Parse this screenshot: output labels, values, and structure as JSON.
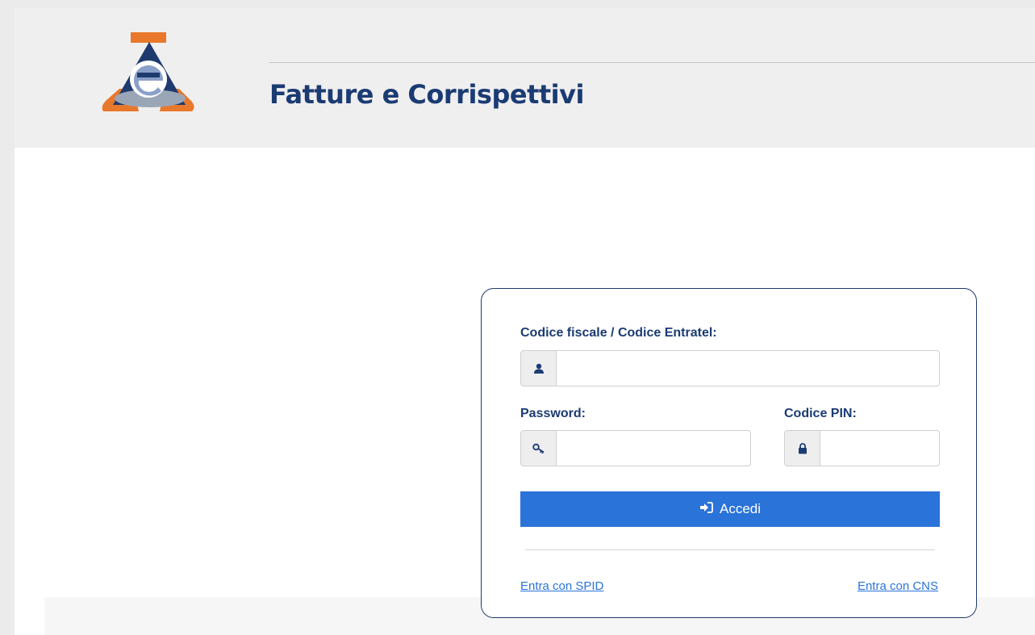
{
  "header": {
    "app_title": "Fatture e Corrispettivi",
    "logo_icon": "agenzia-entrate-logo-icon"
  },
  "login": {
    "username_label": "Codice fiscale / Codice Entratel:",
    "username_value": "",
    "username_icon": "user-icon",
    "password_label": "Password:",
    "password_value": "",
    "password_icon": "key-icon",
    "pin_label": "Codice PIN:",
    "pin_value": "",
    "pin_icon": "lock-icon",
    "submit_label": "Accedi",
    "submit_icon": "sign-in-icon",
    "spid_link": "Entra con SPID",
    "cns_link": "Entra con CNS"
  },
  "colors": {
    "brand_navy": "#1b3b73",
    "brand_orange": "#e8782b",
    "button_blue": "#2a73d9",
    "link_blue": "#2a73d9",
    "header_bg": "#efefef"
  }
}
